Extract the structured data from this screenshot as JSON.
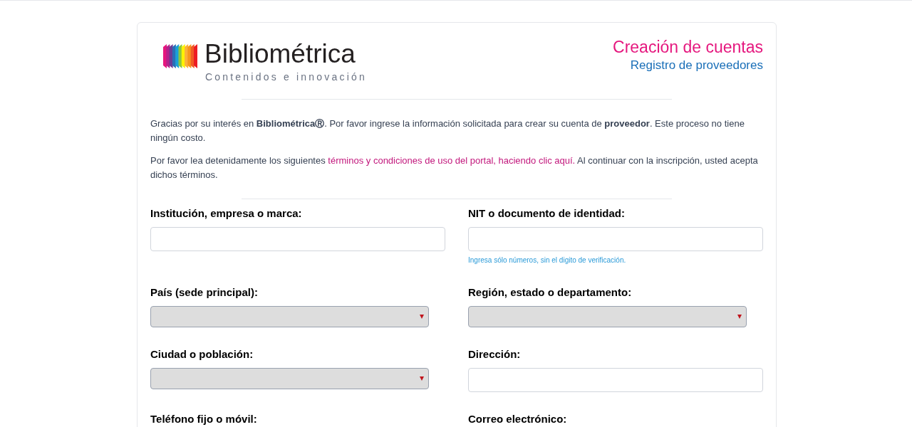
{
  "logo": {
    "name": "Bibliométrica",
    "tagline": "Contenidos e innovación"
  },
  "heading": {
    "title": "Creación de cuentas",
    "subtitle": "Registro de proveedores"
  },
  "intro": "Gracias por su interés en **BibliométricaⓇ**. Por favor ingrese la información solicitada para crear su cuenta de **proveedor**. Este proceso no tiene ningún costo.",
  "terms": {
    "before": "Por favor lea detenidamente los siguientes ",
    "link": "términos y condiciones de uso del portal, haciendo clic aquí.",
    "after": " Al continuar con la inscripción, usted acepta dichos términos."
  },
  "fields": [
    {
      "label": "Institución, empresa o marca:",
      "kind": "text"
    },
    {
      "label": "NIT o documento de identidad:",
      "kind": "text",
      "hint": "Ingresa sólo números, sin el digito de verificación."
    },
    {
      "label": "País (sede principal):",
      "kind": "select"
    },
    {
      "label": "Región, estado o departamento:",
      "kind": "select"
    },
    {
      "label": "Ciudad o población:",
      "kind": "select"
    },
    {
      "label": "Dirección:",
      "kind": "text"
    },
    {
      "label": "Teléfono fijo o móvil:",
      "kind": "label"
    },
    {
      "label": "Correo electrónico:",
      "kind": "label"
    }
  ]
}
